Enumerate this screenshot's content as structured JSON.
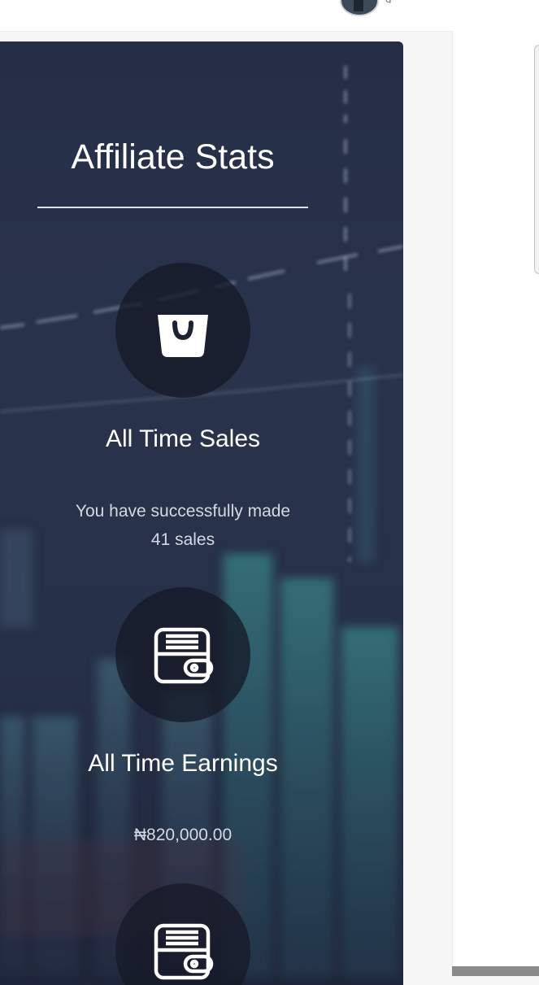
{
  "header": {
    "avatar_icon": "user-avatar",
    "username": "g"
  },
  "card": {
    "title": "Affiliate Stats",
    "stats": [
      {
        "icon": "shopping-bag-icon",
        "label": "All Time Sales",
        "text_line1": "You have successfully made",
        "text_line2": "41 sales"
      },
      {
        "icon": "wallet-icon",
        "label": "All Time Earnings",
        "text_line1": "₦820,000.00"
      },
      {
        "icon": "wallet-icon"
      }
    ]
  },
  "colors": {
    "card_bg": "#252e46",
    "circle_bg": "#161a28",
    "accent_teal": "#3fa39a"
  }
}
